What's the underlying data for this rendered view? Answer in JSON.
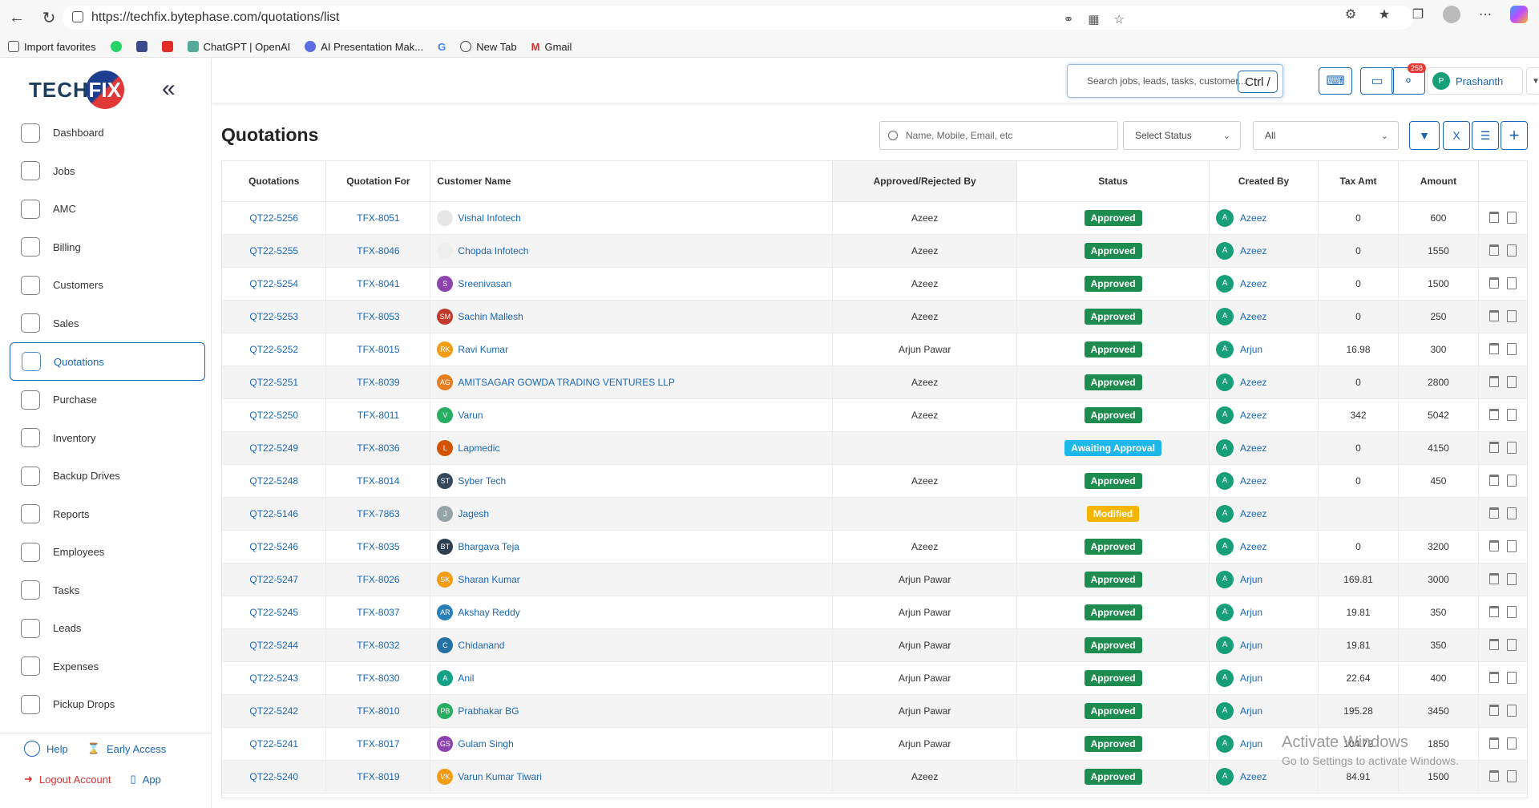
{
  "browser": {
    "url": "https://techfix.bytephase.com/quotations/list",
    "bookmarks": [
      "Import favorites",
      "ChatGPT | OpenAI",
      "AI Presentation Mak...",
      "New Tab",
      "Gmail"
    ]
  },
  "brand": {
    "tech": "TECH",
    "fix": "FIX"
  },
  "sidebar": {
    "items": [
      {
        "label": "Dashboard",
        "icon": "dashboard-icon"
      },
      {
        "label": "Jobs",
        "icon": "jobs-icon"
      },
      {
        "label": "AMC",
        "icon": "amc-icon"
      },
      {
        "label": "Billing",
        "icon": "billing-icon"
      },
      {
        "label": "Customers",
        "icon": "customers-icon"
      },
      {
        "label": "Sales",
        "icon": "sales-icon"
      },
      {
        "label": "Quotations",
        "icon": "quotations-icon",
        "active": true
      },
      {
        "label": "Purchase",
        "icon": "cart-icon"
      },
      {
        "label": "Inventory",
        "icon": "inventory-icon"
      },
      {
        "label": "Backup Drives",
        "icon": "drive-icon"
      },
      {
        "label": "Reports",
        "icon": "reports-icon"
      },
      {
        "label": "Employees",
        "icon": "employees-icon"
      },
      {
        "label": "Tasks",
        "icon": "tasks-icon"
      },
      {
        "label": "Leads",
        "icon": "leads-icon"
      },
      {
        "label": "Expenses",
        "icon": "expenses-icon"
      },
      {
        "label": "Pickup Drops",
        "icon": "pickup-icon"
      }
    ],
    "footer": {
      "help": "Help",
      "early_access": "Early Access",
      "logout": "Logout Account",
      "app": "App"
    }
  },
  "topbar": {
    "search_placeholder": "Search jobs, leads, tasks, customer...",
    "shortcut": "Ctrl /",
    "notification_count": "258",
    "user_initial": "P",
    "user_name": "Prashanth"
  },
  "page": {
    "title": "Quotations",
    "filter_placeholder": "Name, Mobile, Email, etc",
    "status_select": "Select Status",
    "range_select": "All"
  },
  "table": {
    "columns": [
      "Quotations",
      "Quotation For",
      "Customer Name",
      "Approved/Rejected By",
      "Status",
      "Created By",
      "Tax Amt",
      "Amount",
      ""
    ],
    "rows": [
      {
        "q": "QT22-5256",
        "for": "TFX-8051",
        "initials": "",
        "avc": "#e6e6e6",
        "name": "Vishal Infotech",
        "by": "Azeez",
        "status": "Approved",
        "cb": "Azeez",
        "tax": "0",
        "amt": "600"
      },
      {
        "q": "QT22-5255",
        "for": "TFX-8046",
        "initials": "",
        "avc": "#eeeeee",
        "name": "Chopda Infotech",
        "by": "Azeez",
        "status": "Approved",
        "cb": "Azeez",
        "tax": "0",
        "amt": "1550"
      },
      {
        "q": "QT22-5254",
        "for": "TFX-8041",
        "initials": "S",
        "avc": "#8e44ad",
        "name": "Sreenivasan",
        "by": "Azeez",
        "status": "Approved",
        "cb": "Azeez",
        "tax": "0",
        "amt": "1500"
      },
      {
        "q": "QT22-5253",
        "for": "TFX-8053",
        "initials": "SM",
        "avc": "#c0392b",
        "name": "Sachin Mallesh",
        "by": "Azeez",
        "status": "Approved",
        "cb": "Azeez",
        "tax": "0",
        "amt": "250"
      },
      {
        "q": "QT22-5252",
        "for": "TFX-8015",
        "initials": "RK",
        "avc": "#f39c12",
        "name": "Ravi Kumar",
        "by": "Arjun Pawar",
        "status": "Approved",
        "cb": "Arjun",
        "tax": "16.98",
        "amt": "300"
      },
      {
        "q": "QT22-5251",
        "for": "TFX-8039",
        "initials": "AG",
        "avc": "#e67e22",
        "name": "AMITSAGAR GOWDA TRADING VENTURES LLP",
        "by": "Azeez",
        "status": "Approved",
        "cb": "Azeez",
        "tax": "0",
        "amt": "2800"
      },
      {
        "q": "QT22-5250",
        "for": "TFX-8011",
        "initials": "V",
        "avc": "#27ae60",
        "name": "Varun",
        "by": "Azeez",
        "status": "Approved",
        "cb": "Azeez",
        "tax": "342",
        "amt": "5042"
      },
      {
        "q": "QT22-5249",
        "for": "TFX-8036",
        "initials": "L",
        "avc": "#d35400",
        "name": "Lapmedic",
        "by": "",
        "status": "Awaiting Approval",
        "cb": "Azeez",
        "tax": "0",
        "amt": "4150"
      },
      {
        "q": "QT22-5248",
        "for": "TFX-8014",
        "initials": "ST",
        "avc": "#34495e",
        "name": "Syber Tech",
        "by": "Azeez",
        "status": "Approved",
        "cb": "Azeez",
        "tax": "0",
        "amt": "450"
      },
      {
        "q": "QT22-5146",
        "for": "TFX-7863",
        "initials": "J",
        "avc": "#95a5a6",
        "name": "Jagesh",
        "by": "",
        "status": "Modified",
        "cb": "Azeez",
        "tax": "",
        "amt": ""
      },
      {
        "q": "QT22-5246",
        "for": "TFX-8035",
        "initials": "BT",
        "avc": "#2c3e50",
        "name": "Bhargava Teja",
        "by": "Azeez",
        "status": "Approved",
        "cb": "Azeez",
        "tax": "0",
        "amt": "3200"
      },
      {
        "q": "QT22-5247",
        "for": "TFX-8026",
        "initials": "SK",
        "avc": "#f39c12",
        "name": "Sharan Kumar",
        "by": "Arjun Pawar",
        "status": "Approved",
        "cb": "Arjun",
        "tax": "169.81",
        "amt": "3000"
      },
      {
        "q": "QT22-5245",
        "for": "TFX-8037",
        "initials": "AR",
        "avc": "#2980b9",
        "name": "Akshay Reddy",
        "by": "Arjun Pawar",
        "status": "Approved",
        "cb": "Arjun",
        "tax": "19.81",
        "amt": "350"
      },
      {
        "q": "QT22-5244",
        "for": "TFX-8032",
        "initials": "C",
        "avc": "#2471a3",
        "name": "Chidanand",
        "by": "Arjun Pawar",
        "status": "Approved",
        "cb": "Arjun",
        "tax": "19.81",
        "amt": "350"
      },
      {
        "q": "QT22-5243",
        "for": "TFX-8030",
        "initials": "A",
        "avc": "#16a085",
        "name": "Anil",
        "by": "Arjun Pawar",
        "status": "Approved",
        "cb": "Arjun",
        "tax": "22.64",
        "amt": "400"
      },
      {
        "q": "QT22-5242",
        "for": "TFX-8010",
        "initials": "PB",
        "avc": "#27ae60",
        "name": "Prabhakar BG",
        "by": "Arjun Pawar",
        "status": "Approved",
        "cb": "Arjun",
        "tax": "195.28",
        "amt": "3450"
      },
      {
        "q": "QT22-5241",
        "for": "TFX-8017",
        "initials": "GS",
        "avc": "#8e44ad",
        "name": "Gulam Singh",
        "by": "Arjun Pawar",
        "status": "Approved",
        "cb": "Arjun",
        "tax": "104.72",
        "amt": "1850"
      },
      {
        "q": "QT22-5240",
        "for": "TFX-8019",
        "initials": "VK",
        "avc": "#f39c12",
        "name": "Varun Kumar Tiwari",
        "by": "Azeez",
        "status": "Approved",
        "cb": "Azeez",
        "tax": "84.91",
        "amt": "1500"
      }
    ]
  },
  "colors": {
    "accent": "#1a66b5",
    "approved": "#1e8c4e",
    "awaiting": "#1fb6e8",
    "modified": "#f5b400",
    "creator_avatar": "#17a078"
  },
  "watermark": {
    "line1": "Activate Windows",
    "line2": "Go to Settings to activate Windows."
  }
}
